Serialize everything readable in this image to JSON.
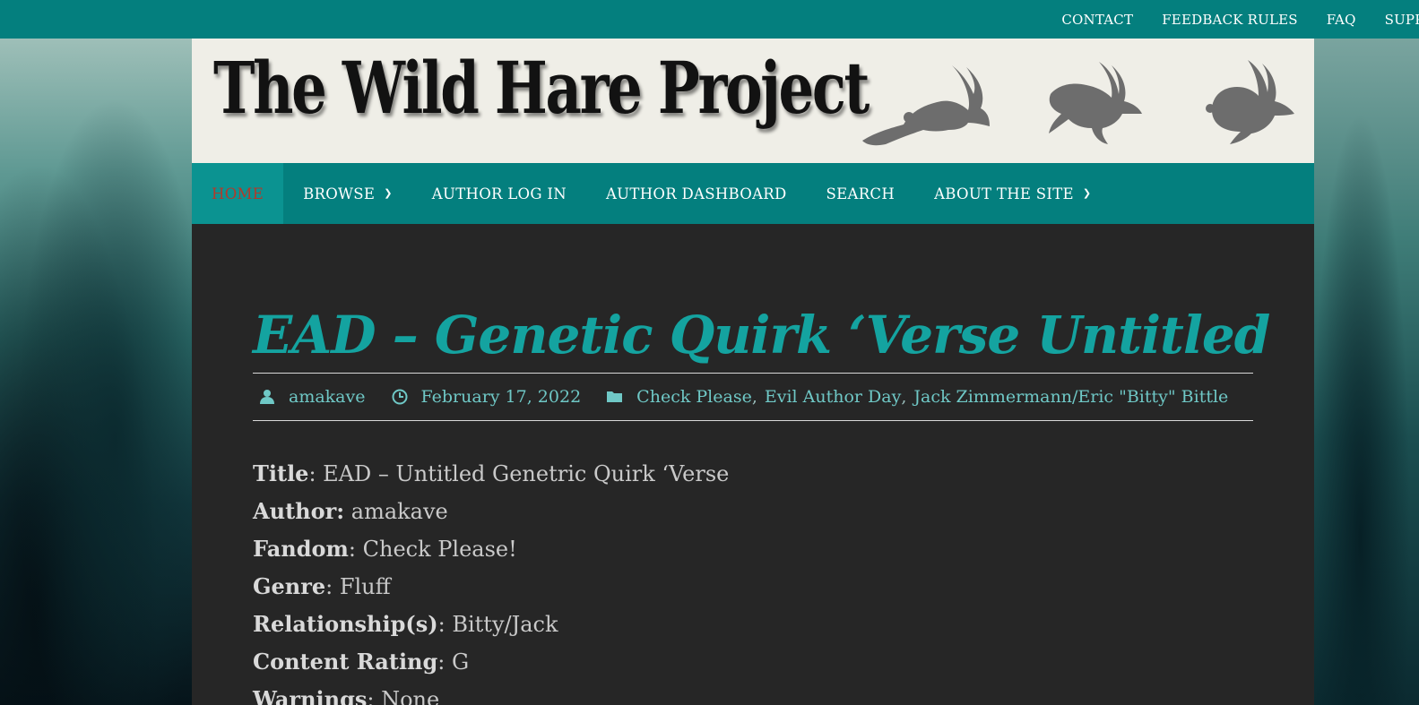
{
  "topbar": {
    "links": [
      "CONTACT",
      "FEEDBACK RULES",
      "FAQ",
      "SUPPO"
    ]
  },
  "site": {
    "logo_text": "The Wild Hare Project"
  },
  "nav": {
    "items": [
      {
        "label": "HOME",
        "active": true
      },
      {
        "label": "BROWSE",
        "has_dropdown": true
      },
      {
        "label": "AUTHOR LOG IN"
      },
      {
        "label": "AUTHOR DASHBOARD"
      },
      {
        "label": "SEARCH"
      },
      {
        "label": "ABOUT THE SITE",
        "has_dropdown": true
      }
    ]
  },
  "post": {
    "title": "EAD – Genetic Quirk ‘Verse Untitled",
    "meta": {
      "author": "amakave",
      "date": "February 17, 2022",
      "categories": [
        "Check Please",
        "Evil Author Day",
        "Jack Zimmermann/Eric \"Bitty\" Bittle"
      ]
    },
    "fields": [
      {
        "label": "Title",
        "value": ": EAD – Untitled Genetric Quirk ‘Verse"
      },
      {
        "label": "Author:",
        "value": " amakave"
      },
      {
        "label": "Fandom",
        "value": ": Check Please!"
      },
      {
        "label": "Genre",
        "value": ": Fluff"
      },
      {
        "label": "Relationship(s)",
        "value": ": Bitty/Jack"
      },
      {
        "label": "Content Rating",
        "value": ": G"
      },
      {
        "label": "Warnings",
        "value": ": None"
      }
    ]
  },
  "colors": {
    "teal": "#047f7e",
    "title_teal": "#14a3a0",
    "active_nav_text": "#b23a2b",
    "content_bg": "#262626"
  }
}
